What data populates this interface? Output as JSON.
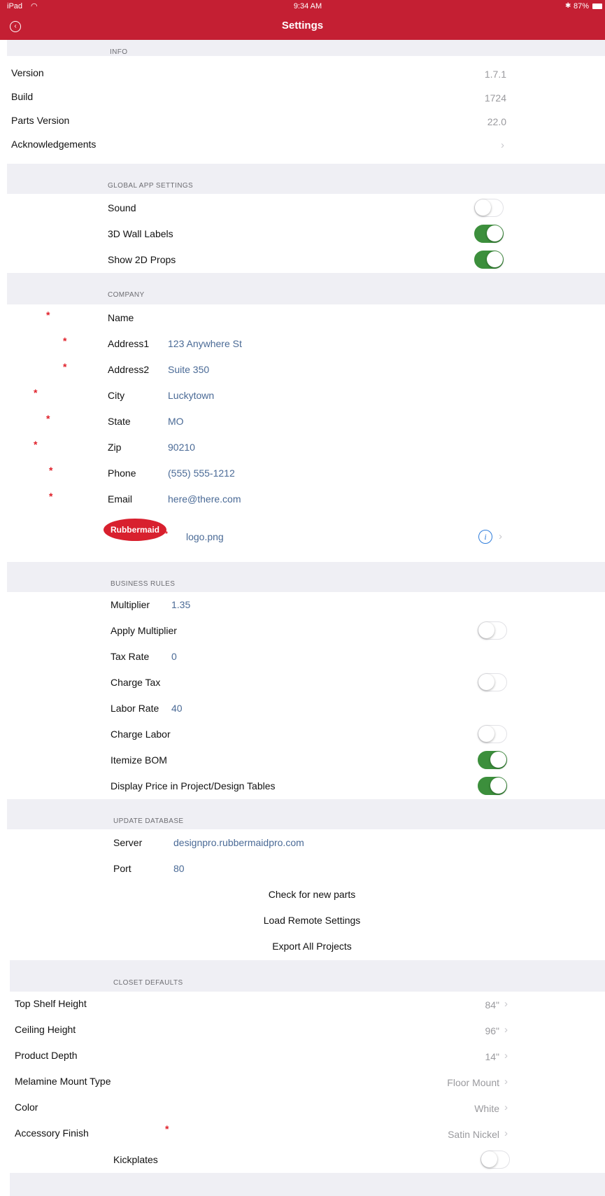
{
  "status_bar": {
    "device": "iPad",
    "time": "9:34 AM",
    "battery": "87%"
  },
  "nav": {
    "title": "Settings"
  },
  "info": {
    "header": "INFO",
    "version_label": "Version",
    "version_value": "1.7.1",
    "build_label": "Build",
    "build_value": "1724",
    "parts_label": "Parts Version",
    "parts_value": "22.0",
    "ack_label": "Acknowledgements"
  },
  "global": {
    "header": "GLOBAL APP SETTINGS",
    "sound_label": "Sound",
    "sound_on": false,
    "labels3d_label": "3D Wall Labels",
    "labels3d_on": true,
    "props2d_label": "Show 2D Props",
    "props2d_on": true
  },
  "company": {
    "header": "COMPANY",
    "name_label": "Name",
    "name_value": "",
    "address1_label": "Address1",
    "address1_value": "123 Anywhere St",
    "address2_label": "Address2",
    "address2_value": "Suite 350",
    "city_label": "City",
    "city_value": "Luckytown",
    "state_label": "State",
    "state_value": "MO",
    "zip_label": "Zip",
    "zip_value": "90210",
    "phone_label": "Phone",
    "phone_value": "(555) 555-1212",
    "email_label": "Email",
    "email_value": "here@there.com",
    "logo_text": "Rubbermaid",
    "logo_file": "logo.png"
  },
  "business": {
    "header": "BUSINESS RULES",
    "multiplier_label": "Multiplier",
    "multiplier_value": "1.35",
    "apply_multiplier_label": "Apply Multiplier",
    "apply_multiplier_on": false,
    "tax_rate_label": "Tax Rate",
    "tax_rate_value": "0",
    "charge_tax_label": "Charge Tax",
    "charge_tax_on": false,
    "labor_rate_label": "Labor Rate",
    "labor_rate_value": "40",
    "charge_labor_label": "Charge Labor",
    "charge_labor_on": false,
    "itemize_bom_label": "Itemize BOM",
    "itemize_bom_on": true,
    "display_price_label": "Display Price in Project/Design Tables",
    "display_price_on": true
  },
  "database": {
    "header": "UPDATE DATABASE",
    "server_label": "Server",
    "server_value": "designpro.rubbermaidpro.com",
    "port_label": "Port",
    "port_value": "80",
    "check_parts": "Check for new parts",
    "load_remote": "Load Remote Settings",
    "export_projects": "Export All Projects"
  },
  "closet": {
    "header": "CLOSET DEFAULTS",
    "top_shelf_label": "Top Shelf Height",
    "top_shelf_value": "84\"",
    "ceiling_label": "Ceiling Height",
    "ceiling_value": "96\"",
    "depth_label": "Product Depth",
    "depth_value": "14\"",
    "mount_label": "Melamine Mount Type",
    "mount_value": "Floor Mount",
    "color_label": "Color",
    "color_value": "White",
    "finish_label": "Accessory Finish",
    "finish_value": "Satin Nickel",
    "kickplates_label": "Kickplates",
    "kickplates_on": false
  },
  "colors": {
    "brand_red": "#c41f33",
    "toggle_green": "#3c8f3c",
    "value_blue": "#4a6a96"
  }
}
